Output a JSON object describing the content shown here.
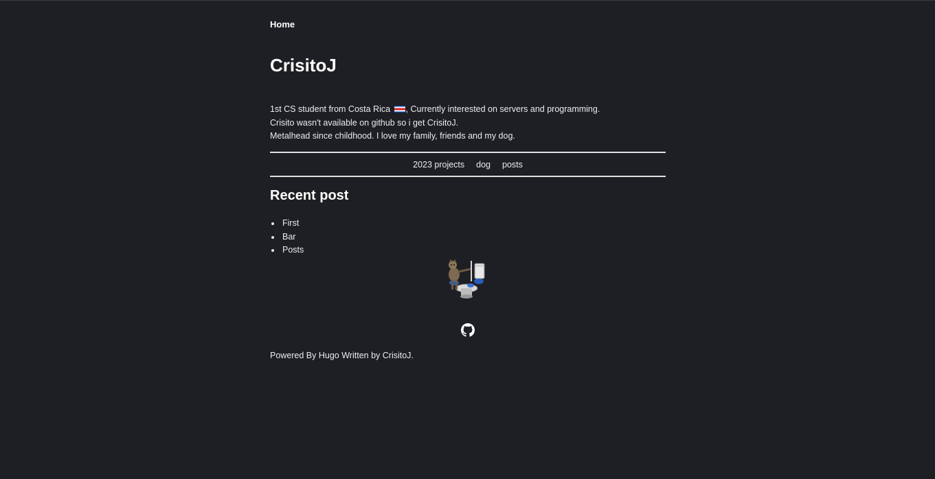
{
  "nav": {
    "home_label": "Home"
  },
  "site": {
    "title": "CrisitoJ"
  },
  "bio": {
    "line1_before_flag": "1st CS student from Costa Rica ",
    "line1_after_flag": ", Currently interested on servers and programming.",
    "line2": "Crisito wasn't available on github so i get CrisitoJ.",
    "line3": "Metalhead since childhood. I love my family, friends and my dog."
  },
  "menu": {
    "items": [
      {
        "label": "2023 projects"
      },
      {
        "label": "dog"
      },
      {
        "label": "posts"
      }
    ]
  },
  "recent": {
    "title": "Recent post",
    "items": [
      {
        "label": "First"
      },
      {
        "label": "Bar"
      },
      {
        "label": "Posts"
      }
    ]
  },
  "footer": {
    "powered_by": "Powered By ",
    "hugo": "Hugo",
    "written_by": " Written by ",
    "author": "CrisitoJ",
    "end": "."
  },
  "icons": {
    "flag": "costa-rica-flag-icon",
    "mascot": "mascot-image",
    "github": "github-icon"
  },
  "colors": {
    "background": "#1e1f24",
    "text": "#ececec",
    "heading": "#ffffff",
    "rule": "#e0e0e0"
  }
}
